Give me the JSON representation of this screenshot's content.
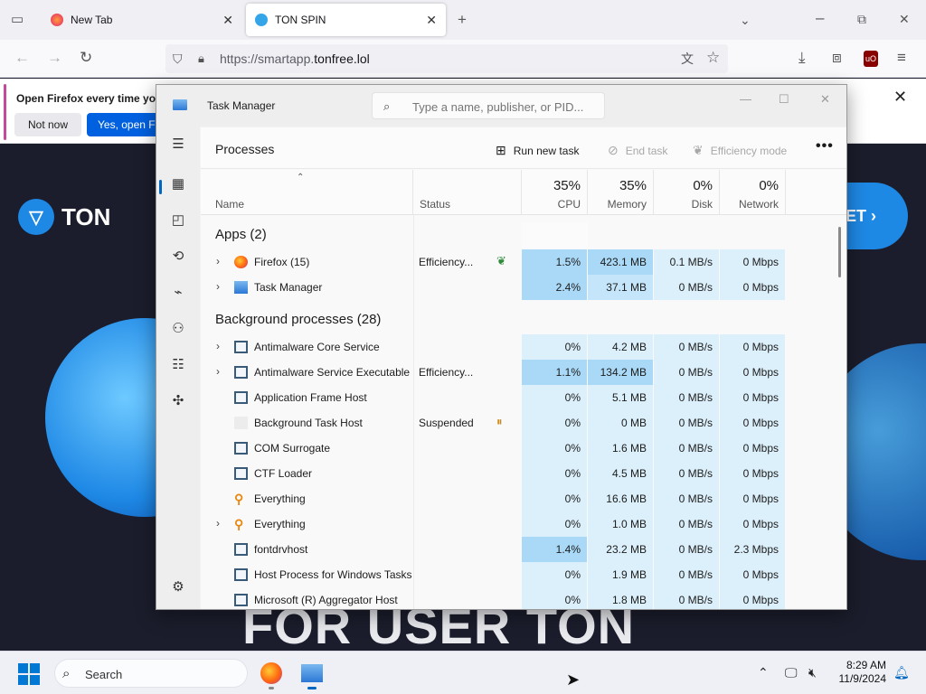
{
  "browser": {
    "tabs": [
      {
        "label": "New Tab",
        "active": false
      },
      {
        "label": "TON SPIN",
        "active": true
      }
    ],
    "url_prefix": "https://smartapp.",
    "url_domain": "tonfree.lol",
    "notification": {
      "message": "Open Firefox every time yo",
      "not_now_label": "Not now",
      "open_label": "Yes, open Fi"
    }
  },
  "page": {
    "logo_text": "TON",
    "cta_label": "ET ›",
    "headline": "FOR USER TON"
  },
  "task_manager": {
    "title": "Task Manager",
    "search_placeholder": "Type a name, publisher, or PID...",
    "section_title": "Processes",
    "toolbar": {
      "run_new_task": "Run new task",
      "end_task": "End task",
      "efficiency_mode": "Efficiency mode",
      "more": "•••"
    },
    "columns": {
      "name": "Name",
      "status": "Status",
      "cpu": {
        "pct": "35%",
        "label": "CPU"
      },
      "memory": {
        "pct": "35%",
        "label": "Memory"
      },
      "disk": {
        "pct": "0%",
        "label": "Disk"
      },
      "network": {
        "pct": "0%",
        "label": "Network"
      }
    },
    "groups": {
      "apps": "Apps (2)",
      "background": "Background processes (28)"
    },
    "apps": [
      {
        "name": "Firefox (15)",
        "status": "Efficiency...",
        "cpu": "1.5%",
        "memory": "423.1 MB",
        "disk": "0.1 MB/s",
        "network": "0 Mbps"
      },
      {
        "name": "Task Manager",
        "status": "",
        "cpu": "2.4%",
        "memory": "37.1 MB",
        "disk": "0 MB/s",
        "network": "0 Mbps"
      }
    ],
    "background": [
      {
        "name": "Antimalware Core Service",
        "status": "",
        "cpu": "0%",
        "memory": "4.2 MB",
        "disk": "0 MB/s",
        "network": "0 Mbps"
      },
      {
        "name": "Antimalware Service Executable",
        "status": "Efficiency...",
        "cpu": "1.1%",
        "memory": "134.2 MB",
        "disk": "0 MB/s",
        "network": "0 Mbps"
      },
      {
        "name": "Application Frame Host",
        "status": "",
        "cpu": "0%",
        "memory": "5.1 MB",
        "disk": "0 MB/s",
        "network": "0 Mbps"
      },
      {
        "name": "Background Task Host",
        "status": "Suspended",
        "cpu": "0%",
        "memory": "0 MB",
        "disk": "0 MB/s",
        "network": "0 Mbps"
      },
      {
        "name": "COM Surrogate",
        "status": "",
        "cpu": "0%",
        "memory": "1.6 MB",
        "disk": "0 MB/s",
        "network": "0 Mbps"
      },
      {
        "name": "CTF Loader",
        "status": "",
        "cpu": "0%",
        "memory": "4.5 MB",
        "disk": "0 MB/s",
        "network": "0 Mbps"
      },
      {
        "name": "Everything",
        "status": "",
        "cpu": "0%",
        "memory": "16.6 MB",
        "disk": "0 MB/s",
        "network": "0 Mbps"
      },
      {
        "name": "Everything",
        "status": "",
        "cpu": "0%",
        "memory": "1.0 MB",
        "disk": "0 MB/s",
        "network": "0 Mbps"
      },
      {
        "name": "fontdrvhost",
        "status": "",
        "cpu": "1.4%",
        "memory": "23.2 MB",
        "disk": "0 MB/s",
        "network": "2.3 Mbps"
      },
      {
        "name": "Host Process for Windows Tasks",
        "status": "",
        "cpu": "0%",
        "memory": "1.9 MB",
        "disk": "0 MB/s",
        "network": "0 Mbps"
      },
      {
        "name": "Microsoft (R) Aggregator Host",
        "status": "",
        "cpu": "0%",
        "memory": "1.8 MB",
        "disk": "0 MB/s",
        "network": "0 Mbps"
      }
    ]
  },
  "taskbar": {
    "search_label": "Search",
    "time": "8:29 AM",
    "date": "11/9/2024"
  }
}
